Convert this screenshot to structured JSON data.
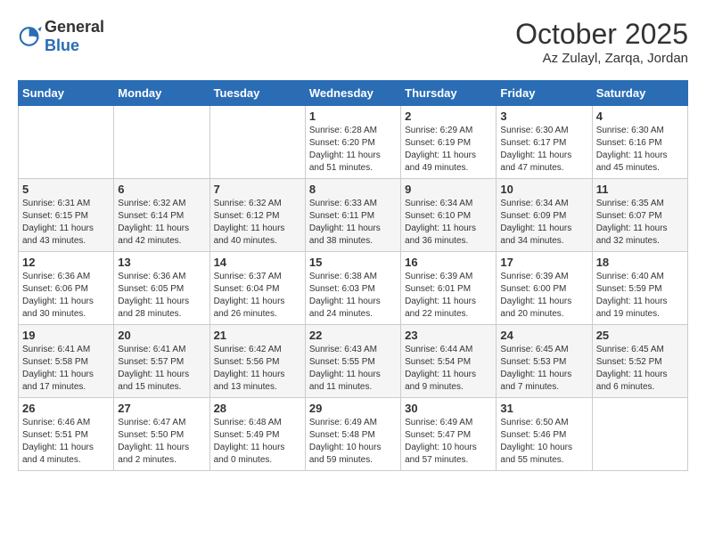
{
  "header": {
    "logo_general": "General",
    "logo_blue": "Blue",
    "month": "October 2025",
    "location": "Az Zulayl, Zarqa, Jordan"
  },
  "weekdays": [
    "Sunday",
    "Monday",
    "Tuesday",
    "Wednesday",
    "Thursday",
    "Friday",
    "Saturday"
  ],
  "weeks": [
    [
      {
        "day": "",
        "info": ""
      },
      {
        "day": "",
        "info": ""
      },
      {
        "day": "",
        "info": ""
      },
      {
        "day": "1",
        "sunrise": "Sunrise: 6:28 AM",
        "sunset": "Sunset: 6:20 PM",
        "daylight": "Daylight: 11 hours and 51 minutes."
      },
      {
        "day": "2",
        "sunrise": "Sunrise: 6:29 AM",
        "sunset": "Sunset: 6:19 PM",
        "daylight": "Daylight: 11 hours and 49 minutes."
      },
      {
        "day": "3",
        "sunrise": "Sunrise: 6:30 AM",
        "sunset": "Sunset: 6:17 PM",
        "daylight": "Daylight: 11 hours and 47 minutes."
      },
      {
        "day": "4",
        "sunrise": "Sunrise: 6:30 AM",
        "sunset": "Sunset: 6:16 PM",
        "daylight": "Daylight: 11 hours and 45 minutes."
      }
    ],
    [
      {
        "day": "5",
        "sunrise": "Sunrise: 6:31 AM",
        "sunset": "Sunset: 6:15 PM",
        "daylight": "Daylight: 11 hours and 43 minutes."
      },
      {
        "day": "6",
        "sunrise": "Sunrise: 6:32 AM",
        "sunset": "Sunset: 6:14 PM",
        "daylight": "Daylight: 11 hours and 42 minutes."
      },
      {
        "day": "7",
        "sunrise": "Sunrise: 6:32 AM",
        "sunset": "Sunset: 6:12 PM",
        "daylight": "Daylight: 11 hours and 40 minutes."
      },
      {
        "day": "8",
        "sunrise": "Sunrise: 6:33 AM",
        "sunset": "Sunset: 6:11 PM",
        "daylight": "Daylight: 11 hours and 38 minutes."
      },
      {
        "day": "9",
        "sunrise": "Sunrise: 6:34 AM",
        "sunset": "Sunset: 6:10 PM",
        "daylight": "Daylight: 11 hours and 36 minutes."
      },
      {
        "day": "10",
        "sunrise": "Sunrise: 6:34 AM",
        "sunset": "Sunset: 6:09 PM",
        "daylight": "Daylight: 11 hours and 34 minutes."
      },
      {
        "day": "11",
        "sunrise": "Sunrise: 6:35 AM",
        "sunset": "Sunset: 6:07 PM",
        "daylight": "Daylight: 11 hours and 32 minutes."
      }
    ],
    [
      {
        "day": "12",
        "sunrise": "Sunrise: 6:36 AM",
        "sunset": "Sunset: 6:06 PM",
        "daylight": "Daylight: 11 hours and 30 minutes."
      },
      {
        "day": "13",
        "sunrise": "Sunrise: 6:36 AM",
        "sunset": "Sunset: 6:05 PM",
        "daylight": "Daylight: 11 hours and 28 minutes."
      },
      {
        "day": "14",
        "sunrise": "Sunrise: 6:37 AM",
        "sunset": "Sunset: 6:04 PM",
        "daylight": "Daylight: 11 hours and 26 minutes."
      },
      {
        "day": "15",
        "sunrise": "Sunrise: 6:38 AM",
        "sunset": "Sunset: 6:03 PM",
        "daylight": "Daylight: 11 hours and 24 minutes."
      },
      {
        "day": "16",
        "sunrise": "Sunrise: 6:39 AM",
        "sunset": "Sunset: 6:01 PM",
        "daylight": "Daylight: 11 hours and 22 minutes."
      },
      {
        "day": "17",
        "sunrise": "Sunrise: 6:39 AM",
        "sunset": "Sunset: 6:00 PM",
        "daylight": "Daylight: 11 hours and 20 minutes."
      },
      {
        "day": "18",
        "sunrise": "Sunrise: 6:40 AM",
        "sunset": "Sunset: 5:59 PM",
        "daylight": "Daylight: 11 hours and 19 minutes."
      }
    ],
    [
      {
        "day": "19",
        "sunrise": "Sunrise: 6:41 AM",
        "sunset": "Sunset: 5:58 PM",
        "daylight": "Daylight: 11 hours and 17 minutes."
      },
      {
        "day": "20",
        "sunrise": "Sunrise: 6:41 AM",
        "sunset": "Sunset: 5:57 PM",
        "daylight": "Daylight: 11 hours and 15 minutes."
      },
      {
        "day": "21",
        "sunrise": "Sunrise: 6:42 AM",
        "sunset": "Sunset: 5:56 PM",
        "daylight": "Daylight: 11 hours and 13 minutes."
      },
      {
        "day": "22",
        "sunrise": "Sunrise: 6:43 AM",
        "sunset": "Sunset: 5:55 PM",
        "daylight": "Daylight: 11 hours and 11 minutes."
      },
      {
        "day": "23",
        "sunrise": "Sunrise: 6:44 AM",
        "sunset": "Sunset: 5:54 PM",
        "daylight": "Daylight: 11 hours and 9 minutes."
      },
      {
        "day": "24",
        "sunrise": "Sunrise: 6:45 AM",
        "sunset": "Sunset: 5:53 PM",
        "daylight": "Daylight: 11 hours and 7 minutes."
      },
      {
        "day": "25",
        "sunrise": "Sunrise: 6:45 AM",
        "sunset": "Sunset: 5:52 PM",
        "daylight": "Daylight: 11 hours and 6 minutes."
      }
    ],
    [
      {
        "day": "26",
        "sunrise": "Sunrise: 6:46 AM",
        "sunset": "Sunset: 5:51 PM",
        "daylight": "Daylight: 11 hours and 4 minutes."
      },
      {
        "day": "27",
        "sunrise": "Sunrise: 6:47 AM",
        "sunset": "Sunset: 5:50 PM",
        "daylight": "Daylight: 11 hours and 2 minutes."
      },
      {
        "day": "28",
        "sunrise": "Sunrise: 6:48 AM",
        "sunset": "Sunset: 5:49 PM",
        "daylight": "Daylight: 11 hours and 0 minutes."
      },
      {
        "day": "29",
        "sunrise": "Sunrise: 6:49 AM",
        "sunset": "Sunset: 5:48 PM",
        "daylight": "Daylight: 10 hours and 59 minutes."
      },
      {
        "day": "30",
        "sunrise": "Sunrise: 6:49 AM",
        "sunset": "Sunset: 5:47 PM",
        "daylight": "Daylight: 10 hours and 57 minutes."
      },
      {
        "day": "31",
        "sunrise": "Sunrise: 6:50 AM",
        "sunset": "Sunset: 5:46 PM",
        "daylight": "Daylight: 10 hours and 55 minutes."
      },
      {
        "day": "",
        "info": ""
      }
    ]
  ]
}
